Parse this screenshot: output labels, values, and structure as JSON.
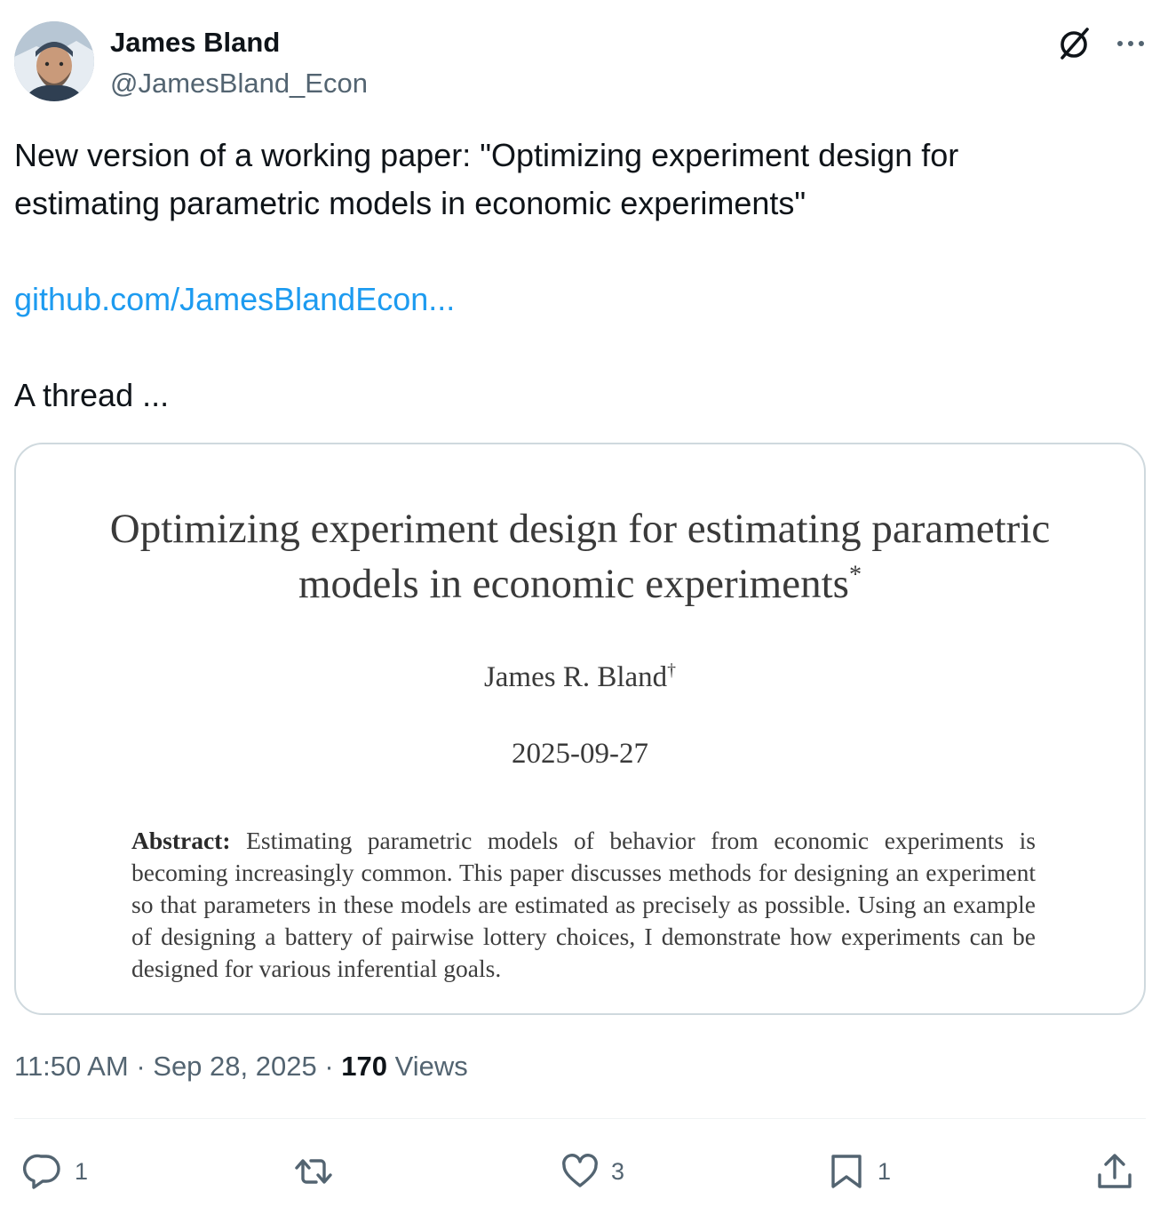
{
  "author": {
    "name": "James Bland",
    "handle": "@JamesBland_Econ"
  },
  "icons": {
    "avatar": "user-photo",
    "grok": "grok-icon",
    "more": "more-icon",
    "reply": "reply-icon",
    "repost": "repost-icon",
    "like": "heart-icon",
    "bookmark": "bookmark-icon",
    "share": "share-icon"
  },
  "tweet": {
    "line1": "New version of a working paper:  \"Optimizing experiment design for",
    "line2": "estimating parametric models in economic experiments\"",
    "link": "github.com/JamesBlandEcon...",
    "line3": "A thread ..."
  },
  "paper": {
    "title_line1": "Optimizing experiment design for estimating parametric",
    "title_line2": "models in economic experiments",
    "title_mark": "*",
    "author": "James R. Bland",
    "author_mark": "†",
    "date": "2025-09-27",
    "abstract_label": "Abstract:",
    "abstract_text": "Estimating parametric models of behavior from economic experiments is becoming increasingly common. This paper discusses methods for designing an experiment so that parameters in these models are estimated as precisely as possible. Using an example of designing a battery of pairwise lottery choices, I demonstrate how experiments can be designed for various inferential goals."
  },
  "meta": {
    "time": "11:50 AM",
    "separator": "·",
    "date": "Sep 28, 2025",
    "views_count": "170",
    "views_label": "Views"
  },
  "actions": {
    "replies": "1",
    "reposts": "",
    "likes": "3",
    "bookmarks": "1"
  },
  "colors": {
    "text": "#0f1419",
    "secondary": "#536471",
    "link": "#1d9bf0",
    "border": "#cfd9de"
  }
}
